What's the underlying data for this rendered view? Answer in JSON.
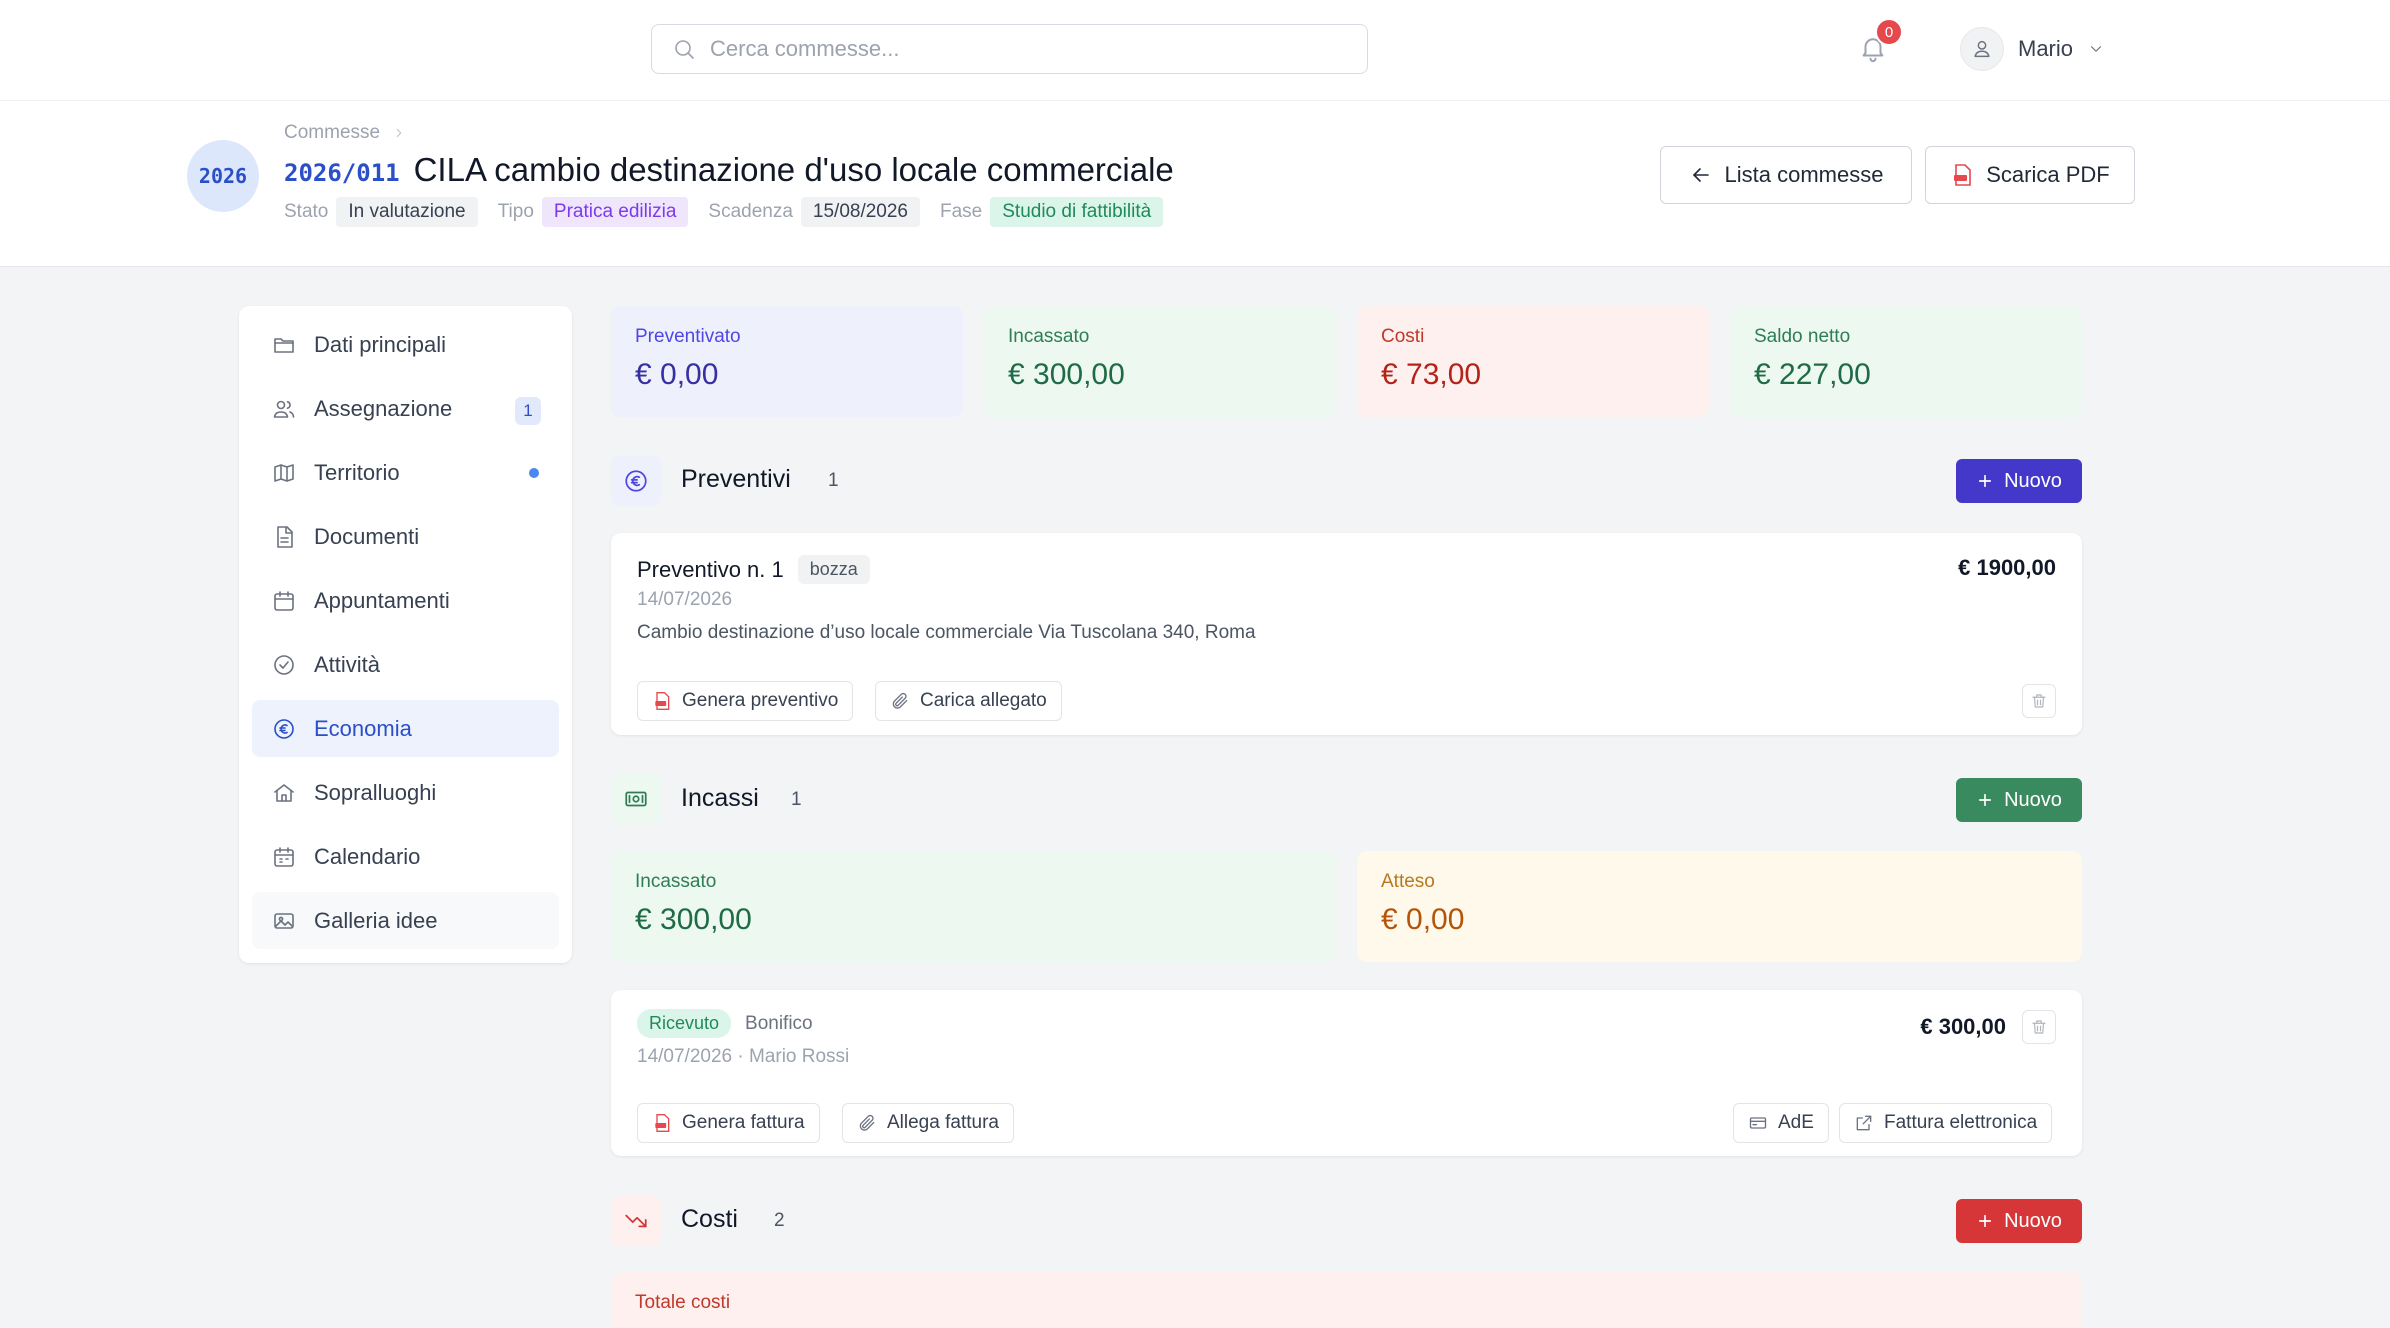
{
  "search": {
    "placeholder": "Cerca commesse..."
  },
  "notifications": {
    "count": "0"
  },
  "user": {
    "name": "Mario"
  },
  "header": {
    "year": "2026",
    "breadcrumb": "Commesse",
    "code": "2026/011",
    "title": "CILA cambio destinazione d'uso locale commerciale",
    "meta": {
      "stato_label": "Stato",
      "stato": "In valutazione",
      "tipo_label": "Tipo",
      "tipo": "Pratica edilizia",
      "scadenza_label": "Scadenza",
      "scadenza": "15/08/2026",
      "fase_label": "Fase",
      "fase": "Studio di fattibilità"
    },
    "back_label": "Lista commesse",
    "pdf_label": "Scarica PDF"
  },
  "sidebar": {
    "items": [
      {
        "label": "Dati principali",
        "icon": "folder-icon"
      },
      {
        "label": "Assegnazione",
        "icon": "users-icon",
        "count": "1"
      },
      {
        "label": "Territorio",
        "icon": "map-icon",
        "dot": true
      },
      {
        "label": "Documenti",
        "icon": "document-icon"
      },
      {
        "label": "Appuntamenti",
        "icon": "calendar-icon"
      },
      {
        "label": "Attività",
        "icon": "check-circle-icon"
      },
      {
        "label": "Economia",
        "icon": "euro-icon",
        "active": true
      },
      {
        "label": "Sopralluoghi",
        "icon": "home-icon"
      },
      {
        "label": "Calendario",
        "icon": "calendar-grid-icon"
      },
      {
        "label": "Galleria idee",
        "icon": "image-icon"
      }
    ]
  },
  "summary": {
    "preventivato": {
      "label": "Preventivato",
      "value": "€ 0,00"
    },
    "incassato": {
      "label": "Incassato",
      "value": "€ 300,00"
    },
    "costi": {
      "label": "Costi",
      "value": "€ 73,00"
    },
    "saldo": {
      "label": "Saldo netto",
      "value": "€ 227,00"
    }
  },
  "preventivi": {
    "title": "Preventivi",
    "count": "1",
    "new_label": "Nuovo",
    "item": {
      "name": "Preventivo n. 1",
      "status": "bozza",
      "amount": "€ 1900,00",
      "date": "14/07/2026",
      "description": "Cambio destinazione d’uso locale commerciale Via Tuscolana 340, Roma",
      "generate_label": "Genera preventivo",
      "attach_label": "Carica allegato"
    }
  },
  "incassi": {
    "title": "Incassi",
    "count": "1",
    "new_label": "Nuovo",
    "incassato_label": "Incassato",
    "incassato_value": "€ 300,00",
    "atteso_label": "Atteso",
    "atteso_value": "€ 0,00",
    "item": {
      "status": "Ricevuto",
      "method": "Bonifico",
      "amount": "€ 300,00",
      "date_person": "14/07/2026 · Mario Rossi",
      "invoice_label": "Genera fattura",
      "attach_label": "Allega fattura",
      "ade_label": "AdE",
      "einvoice_label": "Fattura elettronica"
    }
  },
  "costi": {
    "title": "Costi",
    "count": "2",
    "new_label": "Nuovo",
    "total_label": "Totale costi"
  },
  "colors": {
    "accent": "#4338ca",
    "green_btn": "#3a8a5f",
    "red_btn": "#d63637",
    "blue_text": "#2b4fc7",
    "green_text": "#2e7d54",
    "red_text": "#c0392b",
    "amber_text": "#b7791f"
  }
}
